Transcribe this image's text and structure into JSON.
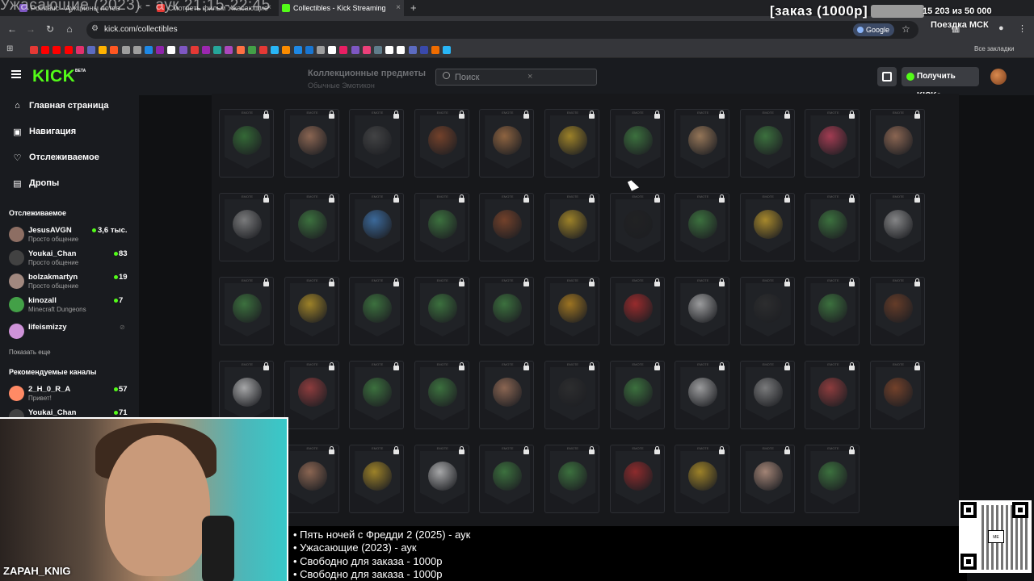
{
  "browser": {
    "tabs": [
      {
        "title": "Pointauc - Аукционы лотов",
        "color": "#7e57c2",
        "active": false
      },
      {
        "title": "Смотреть фильм Ужасающие",
        "color": "#e53935",
        "active": false
      },
      {
        "title": "Collectibles - Kick Streaming",
        "color": "#53fc18",
        "active": true
      }
    ],
    "new_tab": "+",
    "overlay_title": "Ужасающие (2023) - аук 21:15-22:45",
    "url": "kick.com/collectibles",
    "google_chip": "Google",
    "all_bookmarks": "Все закладки",
    "bookmark_colors": [
      "#e53935",
      "#ff0000",
      "#ff0000",
      "#ff0000",
      "#e1306c",
      "#5c6bc0",
      "#ffb300",
      "#ff5722",
      "#9e9e9e",
      "#9e9e9e",
      "#1e88e5",
      "#8e24aa",
      "#fff",
      "#7e57c2",
      "#e53935",
      "#9c27b0",
      "#26a69a",
      "#ab47bc",
      "#ff7043",
      "#43a047",
      "#e53935",
      "#29b6f6",
      "#fb8c00",
      "#1e88e5",
      "#1976d2",
      "#9e9e9e",
      "#fff",
      "#e91e63",
      "#7e57c2",
      "#ec407a",
      "#607d8b",
      "#fff",
      "#fff",
      "#5c6bc0",
      "#3949ab",
      "#ef6c00",
      "#29b6f6"
    ]
  },
  "stream_overlay": {
    "order_label": "[заказ (1000р]",
    "order_progress": "15 203  из 50 000",
    "trip_label": "Поездка МСК",
    "streamer": "ZAPAH_KNIG",
    "orders": [
      "• Пять ночей с Фредди 2 (2025) - аук",
      "• Ужасающие (2023) - аук",
      "• Свободно для заказа - 1000р",
      "• Свободно для заказа - 1000р"
    ],
    "qr_center": "ME"
  },
  "kick": {
    "logo": "KICK",
    "beta": "BETA",
    "heading": "Коллекционные предметы",
    "subheading": "Обычные Эмотикон",
    "search_placeholder": "Поиск",
    "search_clear": "×",
    "get_kicks": "Получить KICKs",
    "nav": [
      {
        "label": "Главная страница",
        "icon": "⌂",
        "name": "home"
      },
      {
        "label": "Навигация",
        "icon": "▣",
        "name": "browse"
      },
      {
        "label": "Отслеживаемое",
        "icon": "♡",
        "name": "following"
      },
      {
        "label": "Дропы",
        "icon": "▤",
        "name": "drops"
      }
    ],
    "following_title": "Отслеживаемое",
    "following": [
      {
        "name": "JesusAVGN",
        "category": "Просто общение",
        "viewers": "3,6 тыс.",
        "live": true,
        "color": "#8d6e63"
      },
      {
        "name": "Youkai_Chan",
        "category": "Просто общение",
        "viewers": "83",
        "live": true,
        "color": "#424242"
      },
      {
        "name": "bolzakmartyn",
        "category": "Просто общение",
        "viewers": "19",
        "live": true,
        "color": "#a1887f"
      },
      {
        "name": "kinozall",
        "category": "Minecraft Dungeons",
        "viewers": "7",
        "live": true,
        "color": "#43a047"
      },
      {
        "name": "lifeismizzy",
        "category": "",
        "viewers": "",
        "live": false,
        "color": "#ce93d8"
      }
    ],
    "show_more": "Показать еще",
    "recommended_title": "Рекомендуемые каналы",
    "recommended": [
      {
        "name": "2_H_0_R_A",
        "category": "Привет!",
        "viewers": "57",
        "color": "#ff8a65"
      },
      {
        "name": "Youkai_Chan",
        "category": "",
        "viewers": "71",
        "color": "#424242"
      }
    ],
    "card_tag": "EMOTE",
    "emote_rows": [
      [
        {
          "c": "#3f8f3f"
        },
        {
          "c": "#c48a6a"
        },
        {
          "c": "#555"
        },
        {
          "c": "#a0522d"
        },
        {
          "c": "#c9874f"
        },
        {
          "c": "#e0b52a"
        },
        {
          "c": "#4b9b4b"
        },
        {
          "c": "#d4a373"
        },
        {
          "c": "#4b9b4b"
        },
        {
          "c": "#e84a6a"
        },
        {
          "c": "#c48a6a"
        }
      ],
      [
        {
          "c": "#aaa"
        },
        {
          "c": "#4b9b4b"
        },
        {
          "c": "#4a8fd8"
        },
        {
          "c": "#4b9b4b"
        },
        {
          "c": "#a0522d"
        },
        {
          "c": "#e0b52a"
        },
        {
          "c": "#222"
        },
        {
          "c": "#4b9b4b"
        },
        {
          "c": "#f0c030"
        },
        {
          "c": "#4b9b4b"
        },
        {
          "c": "#bbb"
        }
      ],
      [
        {
          "c": "#4b9b4b"
        },
        {
          "c": "#e0b52a"
        },
        {
          "c": "#4b9b4b"
        },
        {
          "c": "#4b9b4b"
        },
        {
          "c": "#4b9b4b"
        },
        {
          "c": "#e0a020"
        },
        {
          "c": "#d83030"
        },
        {
          "c": "#ddd"
        },
        {
          "c": "#333"
        },
        {
          "c": "#4b9b4b"
        },
        {
          "c": "#8a4a2a"
        }
      ],
      [
        {
          "c": "#eee"
        },
        {
          "c": "#c84a4a"
        },
        {
          "c": "#4b9b4b"
        },
        {
          "c": "#4b9b4b"
        },
        {
          "c": "#c48a6a"
        },
        {
          "c": "#333"
        },
        {
          "c": "#4b9b4b"
        },
        {
          "c": "#ddd"
        },
        {
          "c": "#aaa"
        },
        {
          "c": "#c84a4a"
        },
        {
          "c": "#a0522d"
        }
      ],
      [
        {
          "c": "#888"
        },
        {
          "c": "#c48a6a"
        },
        {
          "c": "#e0b52a"
        },
        {
          "c": "#eee"
        },
        {
          "c": "#4b9b4b"
        },
        {
          "c": "#4b9b4b"
        },
        {
          "c": "#c83030"
        },
        {
          "c": "#e0b52a"
        },
        {
          "c": "#e8b8a0"
        },
        {
          "c": "#4b9b4b"
        }
      ],
      [
        {
          "c": "#555"
        },
        {
          "c": "#555"
        },
        {
          "c": "#555"
        },
        {
          "c": "#555"
        },
        {
          "c": "#555"
        },
        {
          "c": "#555"
        },
        {
          "c": "#555"
        },
        {
          "c": "#555"
        },
        {
          "c": "#555"
        },
        {
          "c": "#555"
        },
        {
          "c": "#555"
        }
      ]
    ]
  }
}
